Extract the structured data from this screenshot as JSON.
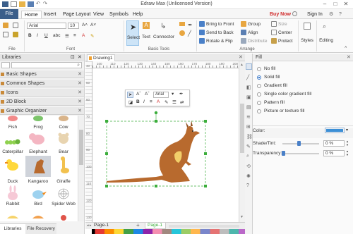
{
  "app": {
    "title": "Edraw Max (Unlicensed Version)"
  },
  "tabs": {
    "file": "File",
    "home": "Home",
    "insert": "Insert",
    "page_layout": "Page Layout",
    "view": "View",
    "symbols": "Symbols",
    "help": "Help",
    "buy_now": "Buy Now",
    "sign_in": "Sign In"
  },
  "ribbon": {
    "font_name": "Arial",
    "font_size": "10",
    "select_label": "Select",
    "text_label": "Text",
    "connector_label": "Connector",
    "bring_front": "Bring to Front",
    "send_back": "Send to Back",
    "rotate_flip": "Rotate & Flip",
    "group": "Group",
    "align": "Align",
    "distribute": "Distribute",
    "center": "Center",
    "size": "Size",
    "protect": "Protect",
    "styles": "Styles",
    "editing": "Editing",
    "grp_file": "File",
    "grp_font": "Font",
    "grp_basic_tools": "Basic Tools",
    "grp_arrange": "Arrange"
  },
  "libraries": {
    "title": "Libraries",
    "sections": [
      "Basic Shapes",
      "Common Shapes",
      "Icons",
      "2D Block",
      "Graphic Organizer"
    ],
    "shapes": [
      "Fish",
      "Frog",
      "Cow",
      "Caterpillar",
      "Elephant",
      "Bear",
      "Duck",
      "Kangaroo",
      "Giraffe",
      "Rabbit",
      "Bird",
      "Spider Web"
    ],
    "bottom_tabs": [
      "Libraries",
      "File Recovery"
    ]
  },
  "document": {
    "tab": "Drawing1",
    "page_tab": "Page-1",
    "page_tab_active": "Page-1",
    "ruler_h": [
      "100",
      "110",
      "120",
      "130",
      "140",
      "150",
      "160",
      "170",
      "180",
      "190",
      "200"
    ],
    "ruler_v": [
      "40",
      "50",
      "60",
      "70",
      "80",
      "90",
      "100",
      "110",
      "120",
      "130"
    ]
  },
  "floating_toolbar": {
    "font": "Arial"
  },
  "fill": {
    "title": "Fill",
    "options": [
      "No fill",
      "Solid fill",
      "Gradient fill",
      "Single color gradient fill",
      "Pattern fill",
      "Picture or texture fill"
    ],
    "selected": 1,
    "color_label": "Color:",
    "shade_label": "Shade/Tint:",
    "shade_value": "0 %",
    "shade_pos": 0.45,
    "transparency_label": "Transparency:",
    "transparency_value": "0 %",
    "transparency_pos": 0.02,
    "color_swatch": "#3c8fd6"
  },
  "colors": {
    "accent": "#3b5e8a",
    "kangaroo": "#b86a2e",
    "buy": "#d02a2a",
    "selection": "#3cae3c"
  }
}
